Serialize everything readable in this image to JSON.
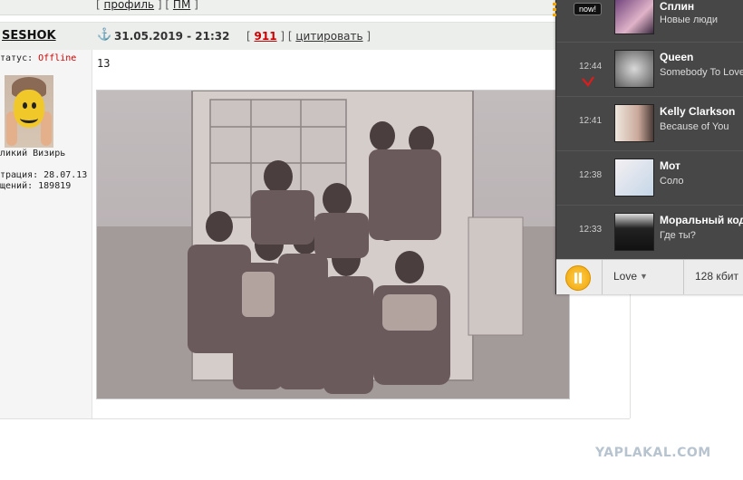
{
  "forum": {
    "top_links": {
      "profile": "профиль",
      "pm": "ПМ"
    },
    "post": {
      "author": "SESHOK",
      "date": "31.05.2019 - 21:32",
      "rating": "911",
      "quote_label": "цитировать",
      "text": "13"
    },
    "user": {
      "status_label": "татус:",
      "status_value": "Offline",
      "rank": "ликий Визирь",
      "registered": "трация: 28.07.13",
      "posts": "щений: 189819"
    },
    "watermark": "YAPLAKAL.COM"
  },
  "player": {
    "now_badge": "now!",
    "tracks": [
      {
        "time": "",
        "artist": "Сплин",
        "song": "Новые люди"
      },
      {
        "time": "12:44",
        "artist": "Queen",
        "song": "Somebody To Love"
      },
      {
        "time": "12:41",
        "artist": "Kelly Clarkson",
        "song": "Because of You"
      },
      {
        "time": "12:38",
        "artist": "Мот",
        "song": "Соло"
      },
      {
        "time": "12:33",
        "artist": "Моральный кодекс",
        "song": "Где ты?"
      }
    ],
    "station": "Love",
    "bitrate": "128 кбит"
  },
  "colors": {
    "accent": "#f0a400",
    "rating": "#cc0000",
    "offline": "#cc0000"
  }
}
